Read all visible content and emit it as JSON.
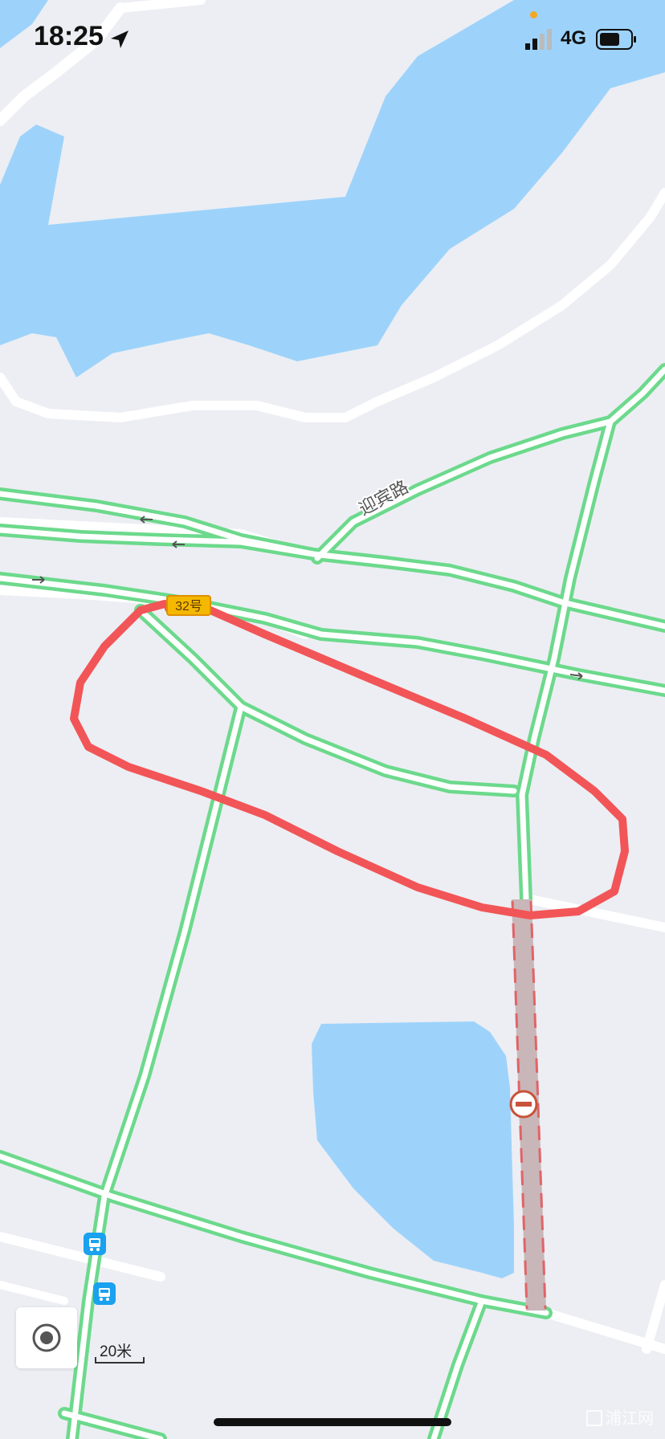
{
  "status_bar": {
    "time": "18:25",
    "network": "4G",
    "location-arrow-icon": "location-arrow-icon",
    "signal-icon": "signal-bars-icon",
    "battery-icon": "battery-icon"
  },
  "map": {
    "road_label": "迎宾路",
    "route_marker_label": "32号",
    "route_color": "#f25557",
    "traffic_color": "#6cd98c",
    "water_color": "#9dd3fb",
    "closure_color": "#c9b6b8",
    "icons": {
      "bus_stop": "bus-stop-icon",
      "closure": "road-closed-icon",
      "direction": "direction-arrow-icon"
    }
  },
  "controls": {
    "locate_icon": "locate-icon",
    "scale_label": "20米"
  },
  "watermark": {
    "text": "浦江网"
  }
}
